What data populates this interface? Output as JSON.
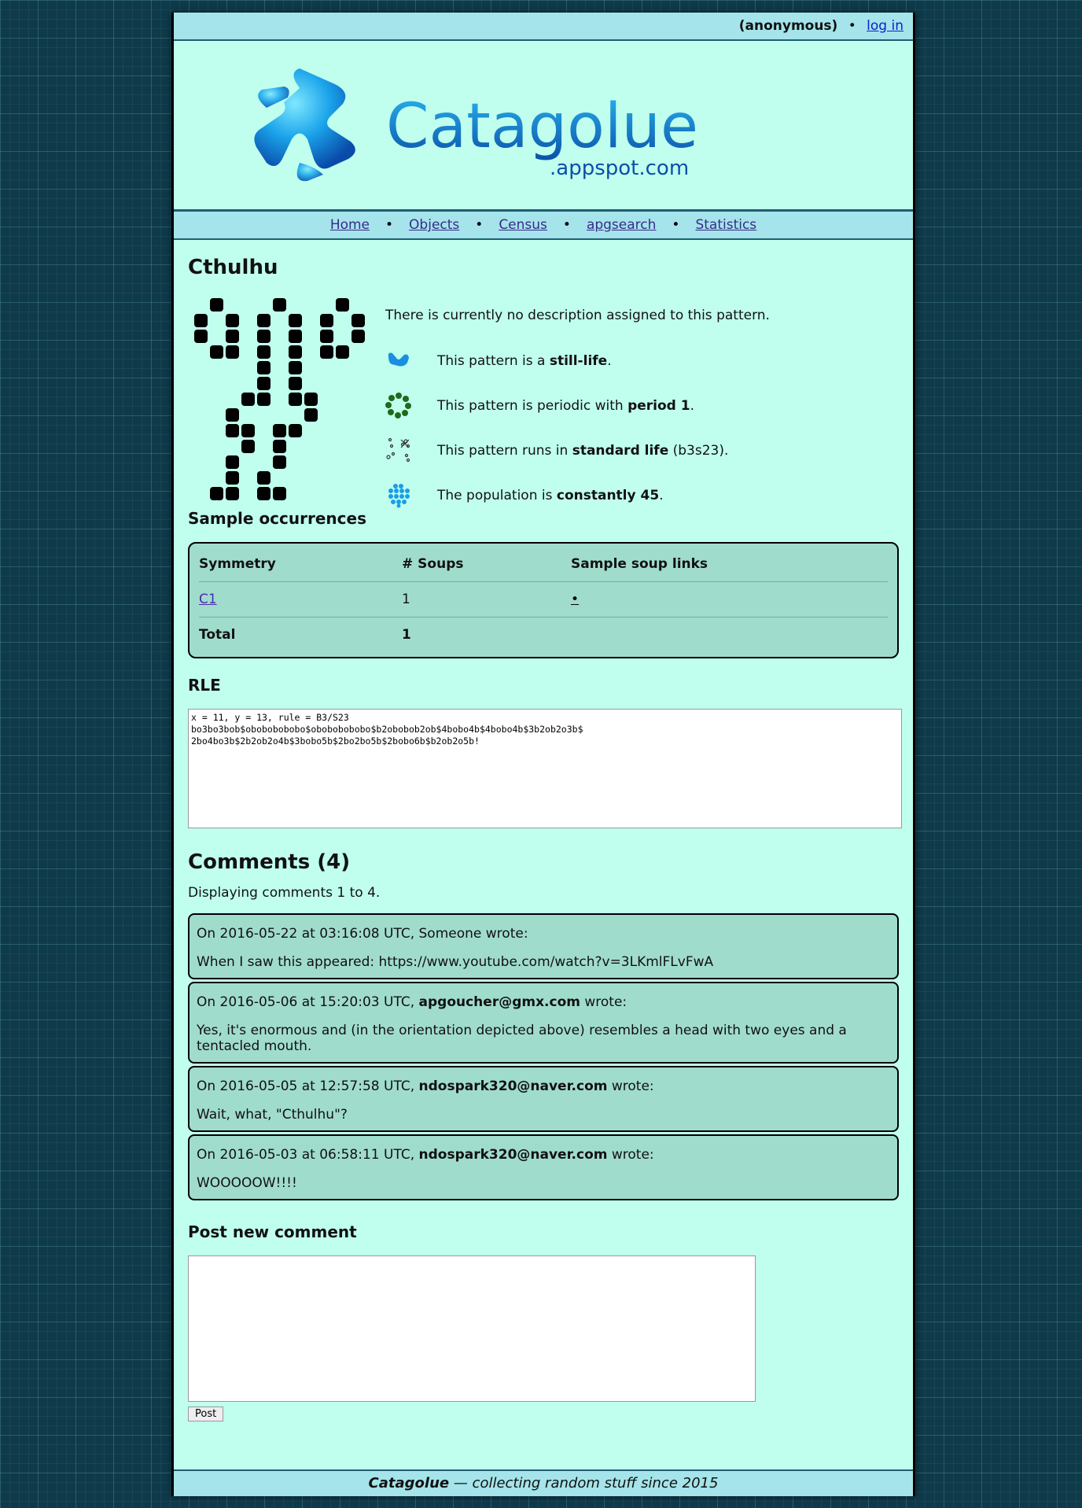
{
  "topbar": {
    "user": "(anonymous)",
    "separator": "•",
    "login": "log in"
  },
  "logo": {
    "name": "Catagolue",
    "domain": ".appspot.com"
  },
  "nav": [
    "Home",
    "Objects",
    "Census",
    "apgsearch",
    "Statistics"
  ],
  "pattern": {
    "title": "Cthulhu",
    "description": "There is currently no description assigned to this pattern.",
    "properties": [
      {
        "icon": "still-life-icon",
        "pre": "This pattern is a ",
        "bold": "still-life",
        "post": "."
      },
      {
        "icon": "periodic-icon",
        "pre": "This pattern is periodic with ",
        "bold": "period 1",
        "post": "."
      },
      {
        "icon": "rule-icon",
        "pre": "This pattern runs in ",
        "bold": "standard life",
        "post": " (b3s23)."
      },
      {
        "icon": "population-icon",
        "pre": "The population is ",
        "bold": "constantly 45",
        "post": "."
      }
    ]
  },
  "occurrences": {
    "heading": "Sample occurrences",
    "headers": [
      "Symmetry",
      "# Soups",
      "Sample soup links"
    ],
    "rows": [
      {
        "symmetry": "C1",
        "soups": "1",
        "link": "•"
      }
    ],
    "total_label": "Total",
    "total": "1"
  },
  "rle": {
    "heading": "RLE",
    "text": "x = 11, y = 13, rule = B3/S23\nbo3bo3bob$obobobobobo$obobobobobo$b2obobob2ob$4bobo4b$4bobo4b$3b2ob2o3b$\n2bo4bo3b$2b2ob2o4b$3bobo5b$2bo2bo5b$2bobo6b$b2ob2o5b!"
  },
  "comments": {
    "heading": "Comments (4)",
    "displaying": "Displaying comments 1 to 4.",
    "items": [
      {
        "prefix": "On 2016-05-22 at 03:16:08 UTC, ",
        "author": "",
        "plain_author": "Someone",
        "suffix": " wrote:",
        "body": "When I saw this appeared: https://www.youtube.com/watch?v=3LKmlFLvFwA"
      },
      {
        "prefix": "On 2016-05-06 at 15:20:03 UTC, ",
        "author": "apgoucher@gmx.com",
        "plain_author": "",
        "suffix": " wrote:",
        "body": "Yes, it's enormous and (in the orientation depicted above) resembles a head with two eyes and a tentacled mouth."
      },
      {
        "prefix": "On 2016-05-05 at 12:57:58 UTC, ",
        "author": "ndospark320@naver.com",
        "plain_author": "",
        "suffix": " wrote:",
        "body": "Wait, what, \"Cthulhu\"?"
      },
      {
        "prefix": "On 2016-05-03 at 06:58:11 UTC, ",
        "author": "ndospark320@naver.com",
        "plain_author": "",
        "suffix": " wrote:",
        "body": "WOOOOOW!!!!"
      }
    ]
  },
  "post": {
    "heading": "Post new comment",
    "button": "Post"
  },
  "footer": {
    "brand": "Catagolue",
    "tagline": " — collecting random stuff since 2015"
  }
}
